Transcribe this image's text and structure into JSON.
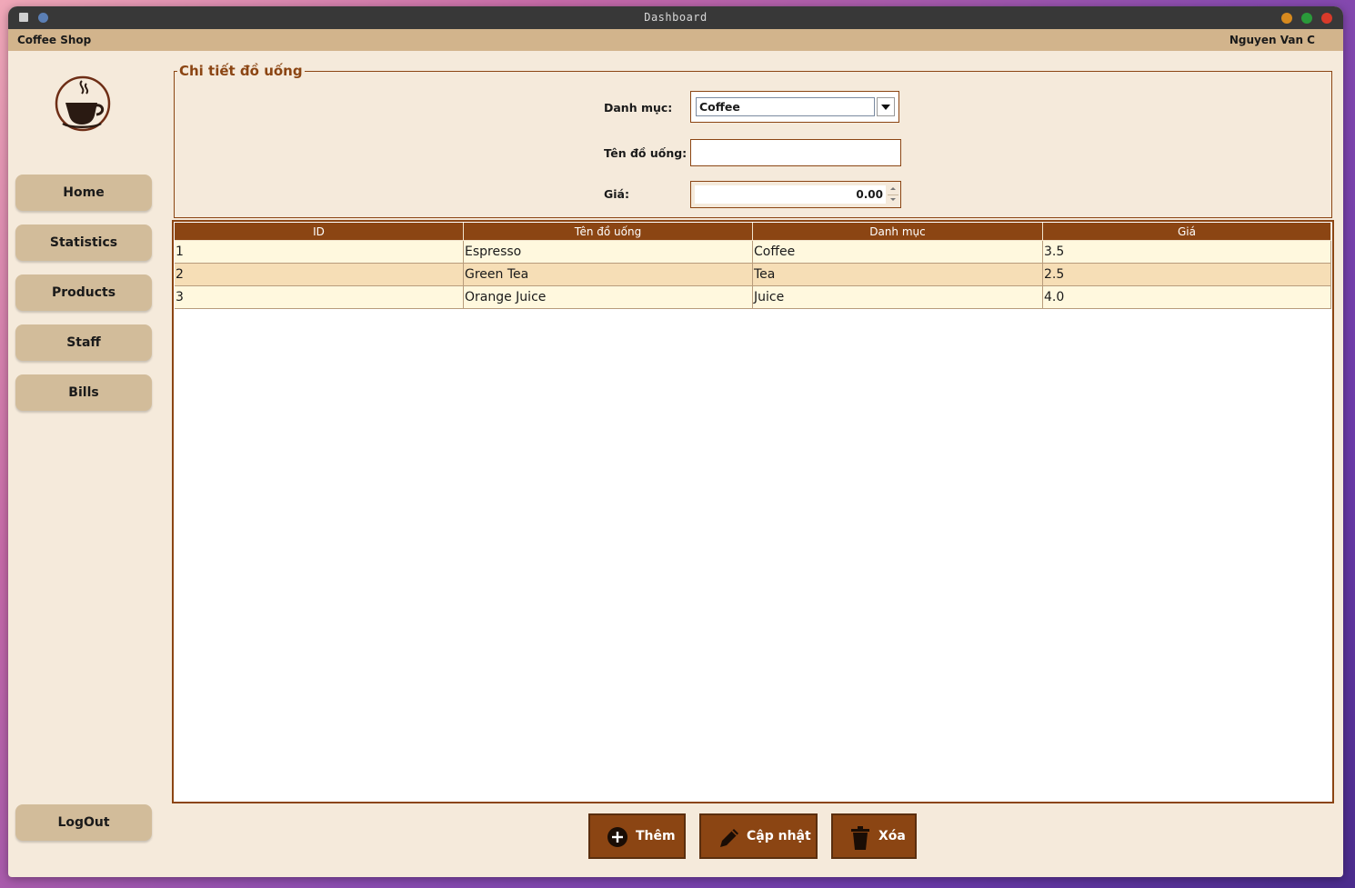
{
  "window": {
    "title": "Dashboard"
  },
  "menubar": {
    "brand": "Coffee Shop",
    "user": "Nguyen Van C"
  },
  "sidebar": {
    "items": [
      {
        "label": "Home"
      },
      {
        "label": "Statistics"
      },
      {
        "label": "Products"
      },
      {
        "label": "Staff"
      },
      {
        "label": "Bills"
      }
    ],
    "logout": "LogOut"
  },
  "details": {
    "legend": "Chi tiết đồ uống",
    "category_label": "Danh mục:",
    "category_value": "Coffee",
    "name_label": "Tên đồ uống:",
    "name_value": "",
    "price_label": "Giá:",
    "price_value": "0.00"
  },
  "table": {
    "headers": [
      "ID",
      "Tên đồ uống",
      "Danh mục",
      "Giá"
    ],
    "rows": [
      [
        "1",
        "Espresso",
        "Coffee",
        "3.5"
      ],
      [
        "2",
        "Green Tea",
        "Tea",
        "2.5"
      ],
      [
        "3",
        "Orange Juice",
        "Juice",
        "4.0"
      ]
    ]
  },
  "actions": {
    "add": "Thêm",
    "update": "Cập nhật",
    "delete": "Xóa"
  },
  "colors": {
    "accent": "#8b4513",
    "panel_bg": "#f5eadb",
    "menubar_bg": "#d2b48c",
    "nav_button": "#d2bc9a",
    "row_odd": "#fff8de",
    "row_even": "#f6deb6"
  },
  "icons": {
    "logo": "coffee-cup-icon",
    "add": "plus-circle-icon",
    "update": "pencil-icon",
    "delete": "trash-icon"
  }
}
